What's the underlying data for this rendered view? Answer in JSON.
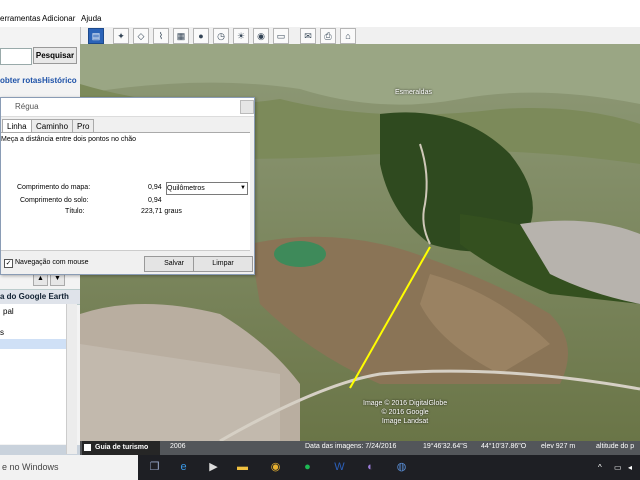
{
  "menu": {
    "items": [
      "erramentas",
      "Adicionar",
      "Ajuda"
    ]
  },
  "sidebar": {
    "search_button": "Pesquisar",
    "tabs": [
      "obter rotas",
      "Histórico"
    ],
    "places_header": "a do Google Earth",
    "places_items": [
      "pal",
      "s"
    ]
  },
  "ruler": {
    "title": "Régua",
    "tabs": [
      "Linha",
      "Caminho",
      "Pro"
    ],
    "description": "Meça a distância entre dois pontos no chão",
    "map_length_label": "Comprimento do mapa:",
    "map_length_value": "0,94",
    "unit_selected": "Quilômetros",
    "ground_length_label": "Comprimento do solo:",
    "ground_length_value": "0,94",
    "heading_label": "Título:",
    "heading_value": "223,71 graus",
    "nav_mouse_label": "Navegação com mouse",
    "save_button": "Salvar",
    "clear_button": "Limpar"
  },
  "map": {
    "place_label": "Esmeraldas",
    "credits": [
      "Image © 2016 DigitalGlobe",
      "© 2016 Google",
      "Image Landsat"
    ]
  },
  "status": {
    "guide": "Guia de turismo",
    "year": "2006",
    "date": "Data das imagens: 7/24/2016",
    "lat": "19°46'32.64\"S",
    "lon": "44°10'37.86\"O",
    "elev": "elev  927 m",
    "eye": "altitude do p"
  },
  "taskbar": {
    "search_text": "e no Windows"
  },
  "colors": {
    "accent": "#2b63b8",
    "ruler_line": "#ffff00"
  }
}
